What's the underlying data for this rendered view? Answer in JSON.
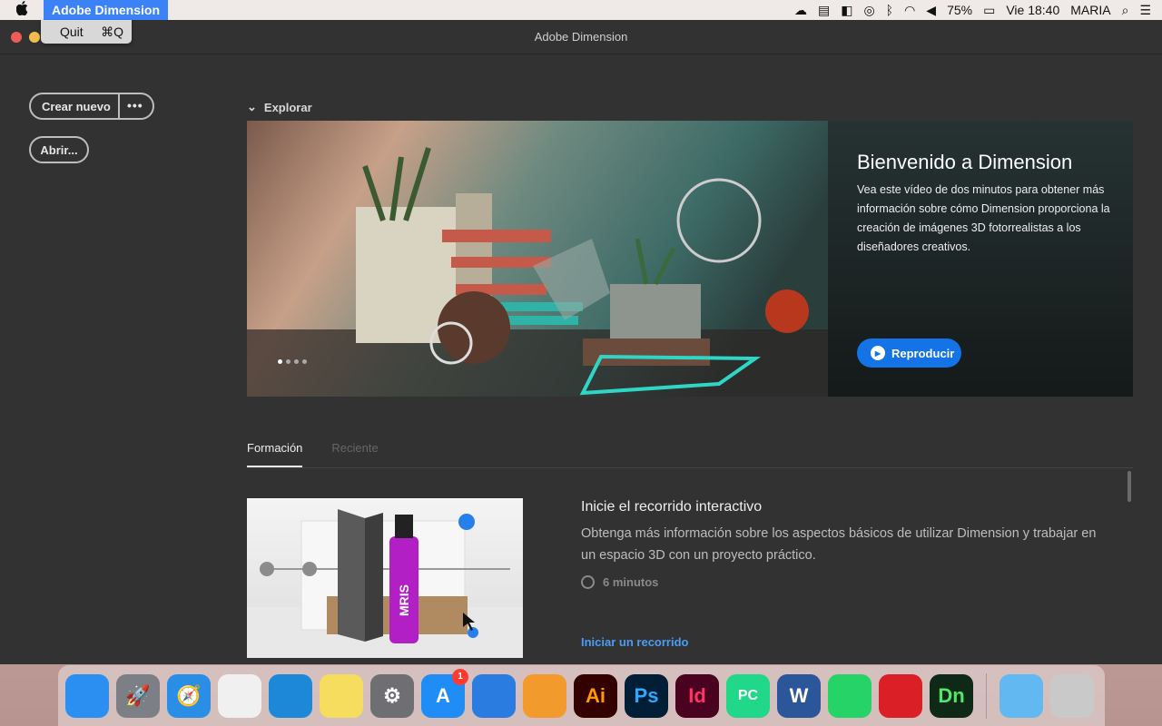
{
  "menubar": {
    "app_name": "Adobe Dimension",
    "battery": "75%",
    "clock": "Vie 18:40",
    "user": "MARIA"
  },
  "quit_menu": {
    "label": "Quit",
    "shortcut": "⌘Q"
  },
  "window": {
    "title": "Adobe Dimension"
  },
  "sidebar": {
    "create_label": "Crear nuevo",
    "more_label": "•••",
    "open_label": "Abrir..."
  },
  "explore": {
    "section_label": "Explorar",
    "hero_title": "Bienvenido a Dimension",
    "hero_text": "Vea este vídeo de dos minutos para obtener más información sobre cómo Dimension proporciona la creación de imágenes 3D fotorrealistas a los diseñadores creativos.",
    "play_label": "Reproducir"
  },
  "tabs": [
    {
      "label": "Formación"
    },
    {
      "label": "Reciente"
    }
  ],
  "course": {
    "title": "Inicie el recorrido interactivo",
    "description": "Obtenga más información sobre los aspectos básicos de utilizar Dimension y trabajar en un espacio 3D con un proyecto práctico.",
    "duration": "6 minutos",
    "link": "Iniciar un recorrido",
    "product_text": "MRIS"
  },
  "dock": {
    "apps": [
      {
        "name": "finder-icon",
        "color": "#2a8ff0",
        "text": ""
      },
      {
        "name": "launchpad-icon",
        "color": "#7d7f86",
        "text": "🚀"
      },
      {
        "name": "safari-icon",
        "color": "#2b8ee6",
        "text": "🧭"
      },
      {
        "name": "chrome-icon",
        "color": "#f0f0f0",
        "text": ""
      },
      {
        "name": "edge-icon",
        "color": "#1e88d8",
        "text": ""
      },
      {
        "name": "notes-icon",
        "color": "#f7dd5e",
        "text": ""
      },
      {
        "name": "system-preferences-icon",
        "color": "#6f6f73",
        "text": "⚙"
      },
      {
        "name": "app-store-icon",
        "color": "#1f8df5",
        "text": "A"
      },
      {
        "name": "keynote-icon",
        "color": "#2b7ce0",
        "text": ""
      },
      {
        "name": "pages-icon",
        "color": "#f39a2d",
        "text": ""
      },
      {
        "name": "illustrator-icon",
        "color": "#330000",
        "text": "Ai"
      },
      {
        "name": "photoshop-icon",
        "color": "#001e36",
        "text": "Ps"
      },
      {
        "name": "indesign-icon",
        "color": "#49021f",
        "text": "Id"
      },
      {
        "name": "pycharm-icon",
        "color": "#21d789",
        "text": "PC"
      },
      {
        "name": "word-icon",
        "color": "#2b579a",
        "text": "W"
      },
      {
        "name": "whatsapp-icon",
        "color": "#25d366",
        "text": ""
      },
      {
        "name": "creative-cloud-icon",
        "color": "#da1f26",
        "text": ""
      },
      {
        "name": "dimension-icon",
        "color": "#0e2a16",
        "text": "Dn"
      }
    ],
    "app_store_badge": "1",
    "trailing": [
      {
        "name": "downloads-folder-icon",
        "color": "#62b8f0",
        "text": ""
      },
      {
        "name": "trash-icon",
        "color": "#c9c9c9",
        "text": ""
      }
    ]
  }
}
